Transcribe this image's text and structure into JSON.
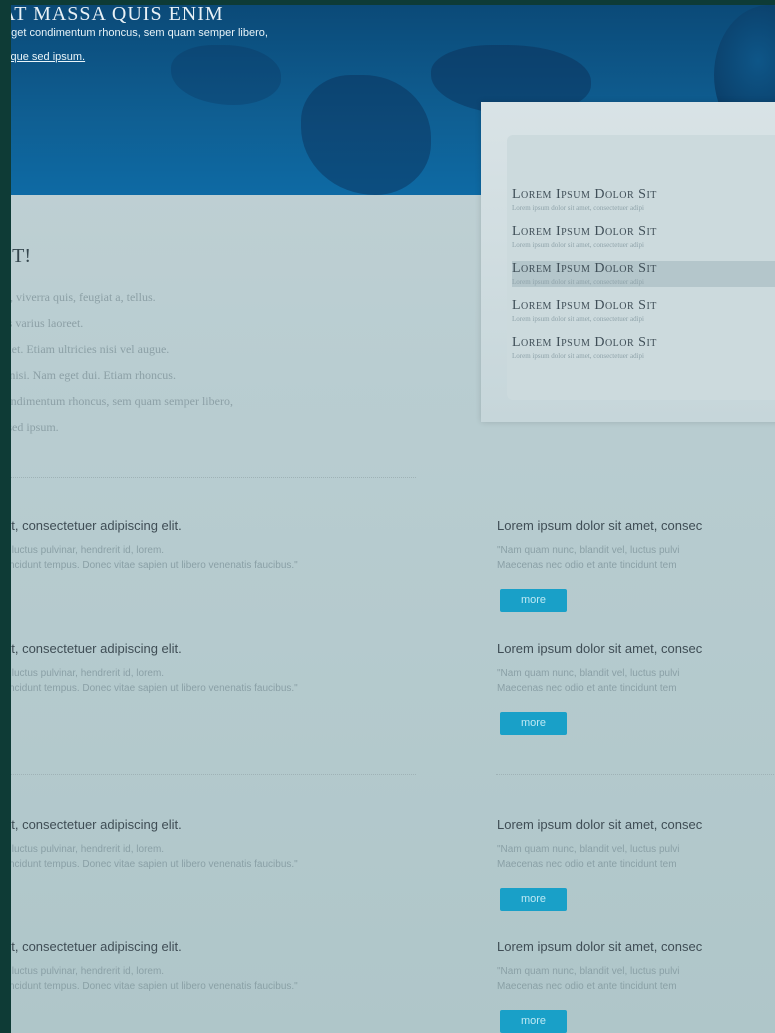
{
  "hero": {
    "title": "AT MASSA QUIS ENIM",
    "text": "eget condimentum rhoncus, sem quam semper libero,",
    "link": "sque sed ipsum."
  },
  "panel_items": [
    {
      "title": "Lorem Ipsum Dolor Sit",
      "sub": "Lorem ipsum dolor sit amet, consectetuer adipi"
    },
    {
      "title": "Lorem Ipsum Dolor Sit",
      "sub": "Lorem ipsum dolor sit amet, consectetuer adipi"
    },
    {
      "title": "Lorem Ipsum Dolor Sit",
      "sub": "Lorem ipsum dolor sit amet, consectetuer adipi"
    },
    {
      "title": "Lorem Ipsum Dolor Sit",
      "sub": "Lorem ipsum dolor sit amet, consectetuer adipi"
    },
    {
      "title": "Lorem Ipsum Dolor Sit",
      "sub": "Lorem ipsum dolor sit amet, consectetuer adipi"
    }
  ],
  "section": {
    "heading": "ST!",
    "lines": [
      "s in, viverra quis, feugiat a, tellus.",
      "ctus varius laoreet.",
      "erdiet. Etiam ultricies nisi vel augue.",
      "ies nisi. Nam eget dui. Etiam rhoncus.",
      "t condimentum rhoncus, sem quam semper libero,",
      "ue sed ipsum."
    ]
  },
  "cards_left": [
    {
      "title": "et, consectetuer adipiscing elit.",
      "line1": "l, luctus pulvinar, hendrerit id, lorem.",
      "line2": "tincidunt tempus. Donec vitae sapien ut libero venenatis faucibus.\""
    },
    {
      "title": "et, consectetuer adipiscing elit.",
      "line1": "l, luctus pulvinar, hendrerit id, lorem.",
      "line2": "tincidunt tempus. Donec vitae sapien ut libero venenatis faucibus.\""
    },
    {
      "title": "et, consectetuer adipiscing elit.",
      "line1": "l, luctus pulvinar, hendrerit id, lorem.",
      "line2": "tincidunt tempus. Donec vitae sapien ut libero venenatis faucibus.\""
    },
    {
      "title": "et, consectetuer adipiscing elit.",
      "line1": "l, luctus pulvinar, hendrerit id, lorem.",
      "line2": "tincidunt tempus. Donec vitae sapien ut libero venenatis faucibus.\""
    }
  ],
  "cards_right": [
    {
      "title": "Lorem ipsum dolor sit amet, consec",
      "line1": "\"Nam quam nunc, blandit vel, luctus pulvi",
      "line2": "Maecenas nec odio et ante tincidunt tem",
      "button": "more"
    },
    {
      "title": "Lorem ipsum dolor sit amet, consec",
      "line1": "\"Nam quam nunc, blandit vel, luctus pulvi",
      "line2": "Maecenas nec odio et ante tincidunt tem",
      "button": "more"
    },
    {
      "title": "Lorem ipsum dolor sit amet, consec",
      "line1": "\"Nam quam nunc, blandit vel, luctus pulvi",
      "line2": "Maecenas nec odio et ante tincidunt tem",
      "button": "more"
    },
    {
      "title": "Lorem ipsum dolor sit amet, consec",
      "line1": "\"Nam quam nunc, blandit vel, luctus pulvi",
      "line2": "Maecenas nec odio et ante tincidunt tem",
      "button": "more"
    }
  ],
  "colors": {
    "hero": "#0f5f93",
    "button": "#19a0c8",
    "frame": "#0e3b36"
  }
}
